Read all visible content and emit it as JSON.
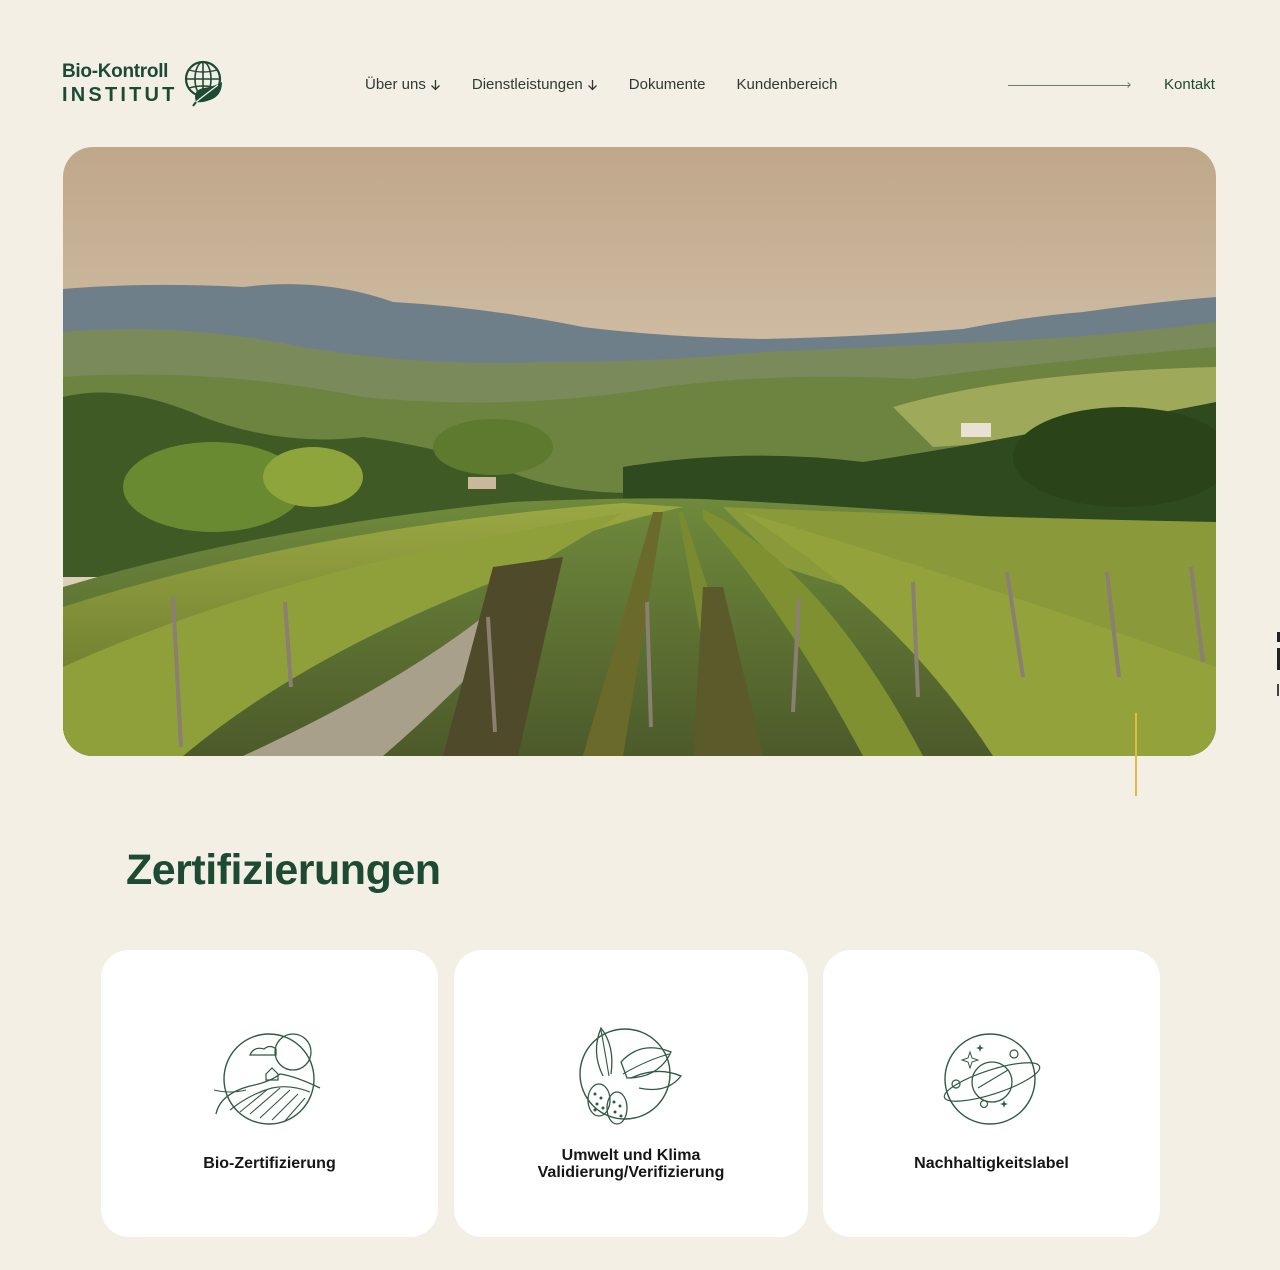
{
  "brand": {
    "line1": "Bio-Kontroll",
    "line2": "INSTITUT"
  },
  "nav": {
    "items": [
      {
        "label": "Über uns",
        "has_arrow": true
      },
      {
        "label": "Dienstleistungen",
        "has_arrow": true
      },
      {
        "label": "Dokumente",
        "has_arrow": false
      },
      {
        "label": "Kundenbereich",
        "has_arrow": false
      }
    ],
    "contact_label": "Kontakt"
  },
  "hero": {
    "image_subject": "vineyard landscape with rolling hills"
  },
  "section": {
    "title": "Zertifizierungen"
  },
  "cards": [
    {
      "label_lines": [
        "Bio-Zertifizierung"
      ],
      "icon": "farm-landscape-icon"
    },
    {
      "label_lines": [
        "Umwelt und Klima",
        "Validierung/Verifizierung"
      ],
      "icon": "leaves-seeds-icon"
    },
    {
      "label_lines": [
        "Nachhaltigkeitslabel"
      ],
      "icon": "planet-orbit-icon"
    }
  ],
  "colors": {
    "background": "#f3efe4",
    "brand_green": "#1d4a33",
    "accent_yellow": "#e2b84a",
    "card_bg": "#ffffff"
  }
}
